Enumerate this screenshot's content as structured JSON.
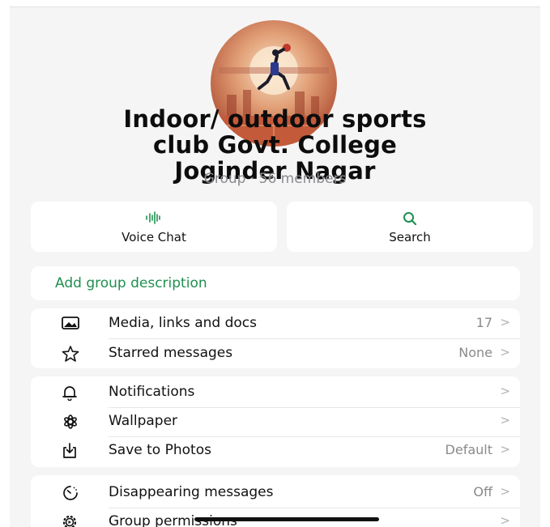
{
  "group": {
    "title_lines": [
      "Indoor/ outdoor sports",
      "club Govt. College",
      "Joginder Nagar"
    ],
    "subtitle": "Group · 56 members"
  },
  "actions": {
    "voice_chat": {
      "label": "Voice Chat",
      "icon": "voice-wave-icon"
    },
    "search": {
      "label": "Search",
      "icon": "search-icon"
    }
  },
  "description": {
    "label": "Add group description"
  },
  "section1": [
    {
      "label": "Media, links and docs",
      "value": "17",
      "icon": "media-icon"
    },
    {
      "label": "Starred messages",
      "value": "None",
      "icon": "star-icon"
    }
  ],
  "section2": [
    {
      "label": "Notifications",
      "value": "",
      "icon": "bell-icon"
    },
    {
      "label": "Wallpaper",
      "value": "",
      "icon": "wallpaper-flower-icon"
    },
    {
      "label": "Save to Photos",
      "value": "Default",
      "icon": "save-download-icon"
    }
  ],
  "section3": [
    {
      "label": "Disappearing messages",
      "value": "Off",
      "icon": "timer-icon"
    },
    {
      "label": "Group permissions",
      "value": "",
      "icon": "gear-icon"
    }
  ],
  "chevron": ">",
  "colors": {
    "accent_green": "#1f8f4e",
    "secondary_text": "#8a8a8e",
    "background": "#f5f5f6"
  }
}
